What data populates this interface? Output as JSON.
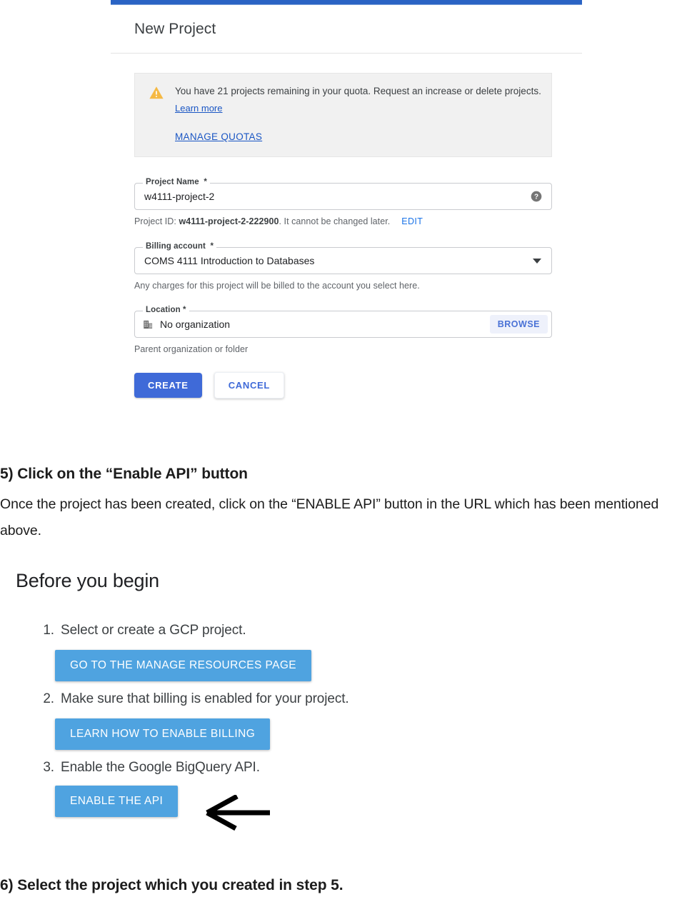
{
  "dialog": {
    "title": "New Project",
    "accent_color": "#2a63c4",
    "quota": {
      "icon": "warning-triangle-icon",
      "message": "You have 21 projects remaining in your quota. Request an increase or delete projects.",
      "learn_more": "Learn more",
      "manage_quotas": "MANAGE QUOTAS"
    },
    "project_name": {
      "label": "Project Name",
      "required_mark": "*",
      "value": "w4111-project-2",
      "help_icon": "help-circle-icon"
    },
    "project_id": {
      "prefix": "Project ID: ",
      "id": "w4111-project-2-222900",
      "suffix": ". It cannot be changed later.",
      "edit_label": "EDIT"
    },
    "billing_account": {
      "label": "Billing account",
      "required_mark": "*",
      "value": "COMS 4111 Introduction to Databases",
      "helper": "Any charges for this project will be billed to the account you select here."
    },
    "location": {
      "label": "Location *",
      "value": "No organization",
      "icon": "organization-building-icon",
      "browse_label": "BROWSE",
      "helper": "Parent organization or folder"
    },
    "create_label": "CREATE",
    "cancel_label": "CANCEL",
    "create_color": "#3f6ad8"
  },
  "doc": {
    "step5_heading": "5) Click on the “Enable API” button",
    "step5_body": "Once the project has been created, click on the “ENABLE API” button in the URL which has been mentioned above.",
    "step6_heading": "6) Select the project which you created in step 5."
  },
  "before_you_begin": {
    "title": "Before you begin",
    "button_color": "#4fa3e0",
    "steps": [
      {
        "number": "1.",
        "text": "Select or create a GCP project.",
        "button": "GO TO THE MANAGE RESOURCES PAGE"
      },
      {
        "number": "2.",
        "text": "Make sure that billing is enabled for your project.",
        "button": "LEARN HOW TO ENABLE BILLING"
      },
      {
        "number": "3.",
        "text": "Enable the Google BigQuery API.",
        "button": "ENABLE THE API",
        "annotation": "left-arrow-annotation"
      }
    ]
  }
}
